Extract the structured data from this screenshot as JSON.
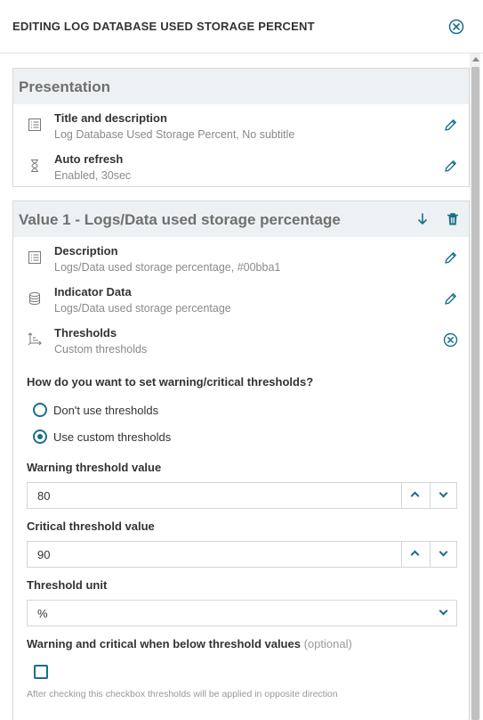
{
  "header": {
    "title": "EDITING LOG DATABASE USED STORAGE PERCENT",
    "close_icon": "close-circle-icon"
  },
  "presentation": {
    "title": "Presentation",
    "rows": [
      {
        "title": "Title and description",
        "subtitle": "Log Database Used Storage Percent, No subtitle",
        "icon": "list-icon",
        "action_icon": "pencil-icon"
      },
      {
        "title": "Auto refresh",
        "subtitle": "Enabled, 30sec",
        "icon": "hourglass-icon",
        "action_icon": "pencil-icon"
      }
    ]
  },
  "value1": {
    "title": "Value 1 - Logs/Data used storage percentage",
    "header_actions": [
      "arrow-down-icon",
      "trash-icon"
    ],
    "rows": [
      {
        "title": "Description",
        "subtitle": "Logs/Data used storage percentage, #00bba1",
        "icon": "list-icon",
        "action_icon": "pencil-icon"
      },
      {
        "title": "Indicator Data",
        "subtitle": "Logs/Data used storage percentage",
        "icon": "database-icon",
        "action_icon": "pencil-icon"
      },
      {
        "title": "Thresholds",
        "subtitle": "Custom thresholds",
        "icon": "axes-icon",
        "action_icon": "close-circle-icon"
      }
    ],
    "thresholds_form": {
      "question": "How do you want to set warning/critical thresholds?",
      "options": [
        {
          "label": "Don't use thresholds",
          "selected": false
        },
        {
          "label": "Use custom thresholds",
          "selected": true
        }
      ],
      "warning_label": "Warning threshold value",
      "warning_value": "80",
      "critical_label": "Critical threshold value",
      "critical_value": "90",
      "unit_label": "Threshold unit",
      "unit_value": "%",
      "below_label": "Warning and critical when below threshold values",
      "below_optional": "(optional)",
      "below_checked": false,
      "below_hint": "After checking this checkbox thresholds will be applied in opposite direction"
    }
  },
  "colors": {
    "accent": "#1a6f8a",
    "header_bg": "#eef1f3",
    "muted_text": "#8a8a8a"
  }
}
